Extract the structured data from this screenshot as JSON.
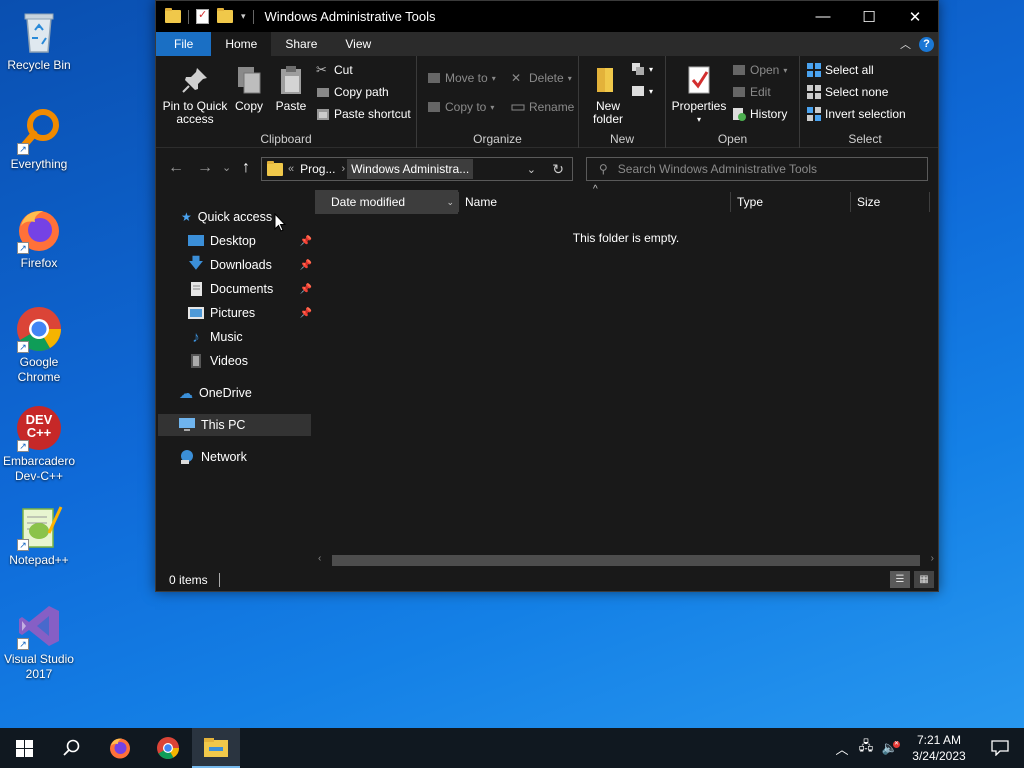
{
  "desktop": {
    "icons": [
      {
        "label": "Recycle Bin",
        "icon": "recycle-bin-icon"
      },
      {
        "label": "Everything",
        "icon": "everything-search-icon"
      },
      {
        "label": "Firefox",
        "icon": "firefox-icon"
      },
      {
        "label": "Google Chrome",
        "icon": "chrome-icon"
      },
      {
        "label": "Embarcadero Dev-C++",
        "icon": "devcpp-icon",
        "badge": "DEV C++"
      },
      {
        "label": "Notepad++",
        "icon": "notepadpp-icon"
      },
      {
        "label": "Visual Studio 2017",
        "icon": "visual-studio-icon"
      }
    ]
  },
  "window": {
    "title": "Windows Administrative Tools",
    "controls": {
      "minimize": "—",
      "maximize": "☐",
      "close": "✕"
    }
  },
  "ribbon_tabs": [
    "File",
    "Home",
    "Share",
    "View"
  ],
  "ribbon": {
    "clipboard": {
      "label": "Clipboard",
      "pin": "Pin to Quick access",
      "copy": "Copy",
      "paste": "Paste",
      "cut": "Cut",
      "copy_path": "Copy path",
      "paste_shortcut": "Paste shortcut"
    },
    "organize": {
      "label": "Organize",
      "move_to": "Move to",
      "copy_to": "Copy to",
      "delete": "Delete",
      "rename": "Rename"
    },
    "new": {
      "label": "New",
      "new_folder": "New folder"
    },
    "open": {
      "label": "Open",
      "properties": "Properties",
      "open": "Open",
      "edit": "Edit",
      "history": "History"
    },
    "select": {
      "label": "Select",
      "select_all": "Select all",
      "select_none": "Select none",
      "invert": "Invert selection"
    }
  },
  "address": {
    "overflow": "«",
    "segments": [
      "Prog...",
      "Windows Administra..."
    ],
    "separator": "›",
    "dropdown": "⌄",
    "refresh": "↻"
  },
  "search": {
    "placeholder": "Search Windows Administrative Tools"
  },
  "nav": {
    "back": "←",
    "forward": "→",
    "recent": "⌄",
    "up": "↑"
  },
  "navpane": {
    "quick_access": "Quick access",
    "items": [
      {
        "label": "Desktop",
        "pinned": true
      },
      {
        "label": "Downloads",
        "pinned": true
      },
      {
        "label": "Documents",
        "pinned": true
      },
      {
        "label": "Pictures",
        "pinned": true
      },
      {
        "label": "Music",
        "pinned": false
      },
      {
        "label": "Videos",
        "pinned": false
      }
    ],
    "onedrive": "OneDrive",
    "this_pc": "This PC",
    "network": "Network"
  },
  "columns": [
    "Date modified",
    "Name",
    "Type",
    "Size"
  ],
  "content": {
    "empty_message": "This folder is empty."
  },
  "status": {
    "items": "0 items"
  },
  "taskbar": {
    "time": "7:21 AM",
    "date": "3/24/2023"
  },
  "colors": {
    "accent": "#1a6fc4",
    "window_bg": "#191919",
    "folder": "#f0c84a"
  }
}
